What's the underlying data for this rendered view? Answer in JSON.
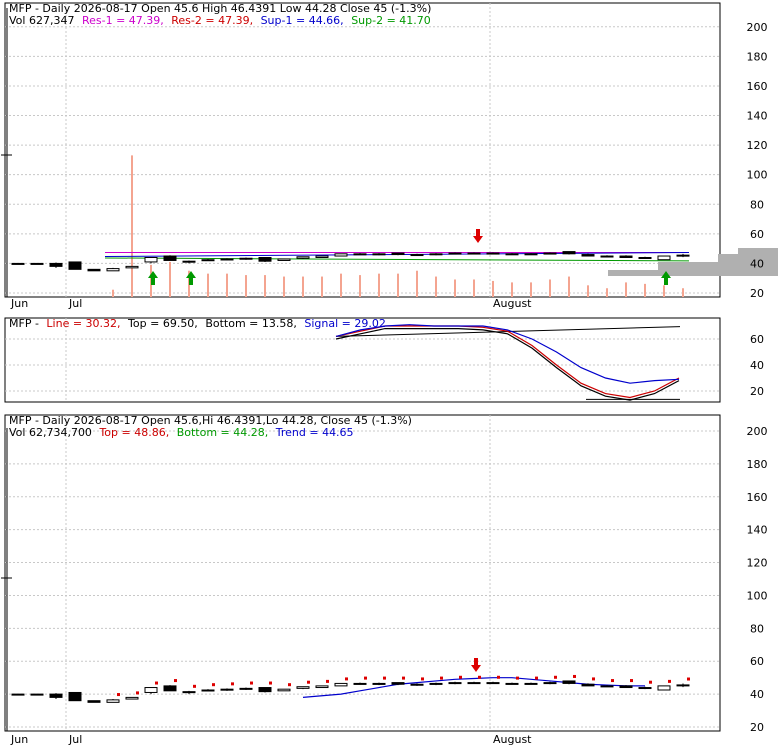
{
  "top_panel": {
    "header_line1": "MFP - Daily 2026-08-17 Open 45.6  High 46.4391  Low 44.28  Close 45 (-1.3%)",
    "vol_label": "Vol 627,347",
    "res1": "Res-1 = 47.39,",
    "res2": "Res-2 = 47.39,",
    "sup1": "Sup-1 = 44.66,",
    "sup2": "Sup-2 = 41.70"
  },
  "middle_panel": {
    "ticker": "MFP -",
    "line": "Line = 30.32,",
    "top": "Top = 69.50,",
    "bottom": "Bottom = 13.58,",
    "signal": "Signal = 29.02"
  },
  "bottom_panel": {
    "header_line1": "MFP - Daily 2026-08-17 Open 45.6,Hi 46.4391,Lo 44.28, Close 45 (-1.3%)",
    "vol_label": "Vol 62,734,700",
    "top": "Top = 48.86,",
    "bottom": "Bottom = 44.28,",
    "trend": "Trend = 44.65"
  },
  "x_labels": [
    "Jun",
    "Jul",
    "August"
  ],
  "colors": {
    "res1": "#cc00cc",
    "res2": "#cc0000",
    "sup1": "#0000cc",
    "sup2": "#009900",
    "volume": "#f4a490",
    "up_arrow": "#009900",
    "down_arrow": "#dd0000",
    "signal_line": "#0000cc",
    "osc_line": "#cc0000",
    "trend_line": "#0000cc"
  },
  "chart_data": [
    {
      "type": "candlestick",
      "panel": "price-volume",
      "ylim": [
        20,
        210
      ],
      "yticks": [
        20,
        40,
        60,
        80,
        100,
        120,
        140,
        160,
        180,
        200
      ],
      "candles": [
        {
          "o": 40,
          "h": 40,
          "l": 40,
          "c": 40
        },
        {
          "o": 40,
          "h": 40,
          "l": 40,
          "c": 40
        },
        {
          "o": 40,
          "h": 40.6,
          "l": 37,
          "c": 38
        },
        {
          "o": 41,
          "h": 41,
          "l": 36,
          "c": 36
        },
        {
          "o": 36,
          "h": 36,
          "l": 35,
          "c": 35
        },
        {
          "o": 35,
          "h": 37,
          "l": 35,
          "c": 36.5
        },
        {
          "o": 37,
          "h": 38,
          "l": 37,
          "c": 38
        },
        {
          "o": 41,
          "h": 44,
          "l": 40,
          "c": 44
        },
        {
          "o": 45,
          "h": 45.5,
          "l": 42,
          "c": 42
        },
        {
          "o": 41,
          "h": 42,
          "l": 40,
          "c": 41.5
        },
        {
          "o": 42,
          "h": 43,
          "l": 42,
          "c": 42.5
        },
        {
          "o": 43,
          "h": 43.5,
          "l": 42,
          "c": 42.5
        },
        {
          "o": 43,
          "h": 44,
          "l": 42.5,
          "c": 43.5
        },
        {
          "o": 44,
          "h": 44,
          "l": 41,
          "c": 41.5
        },
        {
          "o": 42,
          "h": 43,
          "l": 42,
          "c": 43
        },
        {
          "o": 43.5,
          "h": 44.5,
          "l": 43,
          "c": 44.5
        },
        {
          "o": 44,
          "h": 45,
          "l": 44,
          "c": 45
        },
        {
          "o": 45,
          "h": 46.5,
          "l": 45,
          "c": 46.5
        },
        {
          "o": 46,
          "h": 47,
          "l": 46,
          "c": 46.5
        },
        {
          "o": 46.5,
          "h": 47,
          "l": 45.5,
          "c": 46.5
        },
        {
          "o": 47,
          "h": 47,
          "l": 45.5,
          "c": 46
        },
        {
          "o": 46,
          "h": 46.5,
          "l": 45,
          "c": 45.5
        },
        {
          "o": 46,
          "h": 47,
          "l": 45.5,
          "c": 46.5
        },
        {
          "o": 46.5,
          "h": 47.5,
          "l": 46,
          "c": 47
        },
        {
          "o": 47,
          "h": 47.5,
          "l": 46.5,
          "c": 47
        },
        {
          "o": 47,
          "h": 47.5,
          "l": 46.5,
          "c": 47
        },
        {
          "o": 46.5,
          "h": 47,
          "l": 46,
          "c": 46.5
        },
        {
          "o": 46.5,
          "h": 47,
          "l": 46,
          "c": 46.5
        },
        {
          "o": 47,
          "h": 47.5,
          "l": 46,
          "c": 46.5
        },
        {
          "o": 48,
          "h": 48,
          "l": 46,
          "c": 46.5
        },
        {
          "o": 46,
          "h": 46.5,
          "l": 45,
          "c": 45
        },
        {
          "o": 45,
          "h": 45.5,
          "l": 44.5,
          "c": 44.5
        },
        {
          "o": 45,
          "h": 45.5,
          "l": 44,
          "c": 44
        },
        {
          "o": 44,
          "h": 44.5,
          "l": 43,
          "c": 43.5
        },
        {
          "o": 42.5,
          "h": 45,
          "l": 42.5,
          "c": 45
        },
        {
          "o": 45.6,
          "h": 46.4391,
          "l": 44.28,
          "c": 45
        }
      ],
      "volume_rel": [
        0,
        0,
        0,
        0,
        0,
        0.05,
        0.97,
        0.22,
        0.24,
        0.18,
        0.16,
        0.16,
        0.15,
        0.15,
        0.14,
        0.14,
        0.14,
        0.16,
        0.15,
        0.16,
        0.16,
        0.18,
        0.14,
        0.12,
        0.12,
        0.11,
        0.1,
        0.1,
        0.12,
        0.14,
        0.08,
        0.06,
        0.1,
        0.09,
        0.08,
        0.06
      ],
      "resistance": {
        "x": [
          5,
          35
        ],
        "y": [
          47.39,
          47.39
        ]
      },
      "support": {
        "x": [
          5,
          35
        ],
        "y": [
          44.66,
          41.7
        ]
      },
      "up_arrows": [
        7,
        9,
        34
      ],
      "down_arrows": [
        24
      ]
    },
    {
      "type": "line",
      "panel": "oscillator",
      "ylim": [
        8,
        75
      ],
      "yticks": [
        20,
        40,
        60
      ],
      "series": [
        {
          "values": [
            62,
            66,
            70,
            70,
            70,
            70,
            69,
            66,
            55,
            40,
            26,
            18,
            15,
            20,
            30
          ]
        },
        {
          "values": [
            62,
            67,
            70,
            71,
            70,
            70,
            70,
            67,
            60,
            50,
            38,
            30,
            26,
            28,
            29
          ]
        }
      ],
      "top_level": [
        62,
        69.5
      ],
      "bottom_level": [
        13.58,
        13.58
      ]
    },
    {
      "type": "candlestick",
      "panel": "price-trend",
      "ylim": [
        17,
        210
      ],
      "yticks": [
        20,
        40,
        60,
        80,
        100,
        120,
        140,
        160,
        180,
        200
      ],
      "trend": [
        38,
        39,
        40,
        42,
        44,
        46,
        47,
        48,
        49,
        49.5,
        50,
        50,
        49,
        48,
        47,
        46,
        45.5,
        45,
        45
      ]
    }
  ]
}
